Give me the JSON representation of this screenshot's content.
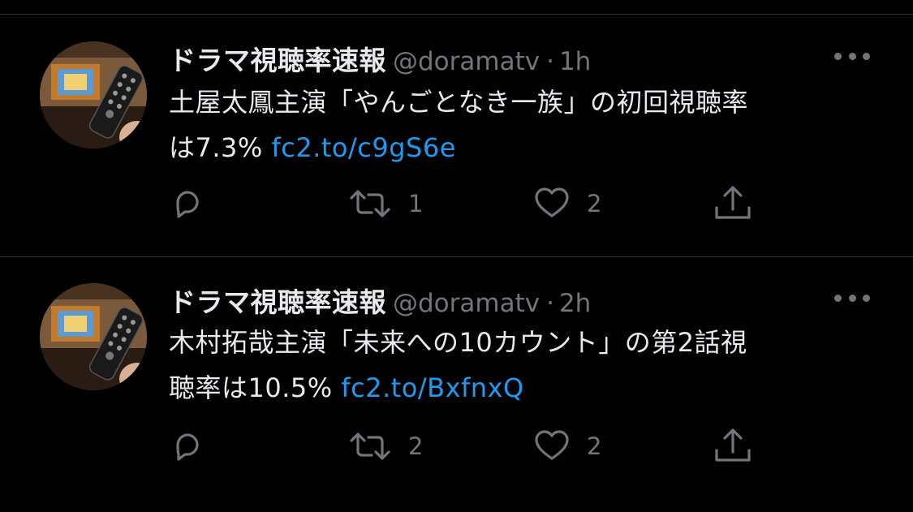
{
  "tweets": [
    {
      "name": "ドラマ視聴率速報",
      "handle": "@doramatv",
      "time": "1h",
      "text_line1": "土屋太鳳主演「やんごとなき一族」の初回視聴率",
      "text_line2": "は7.3%",
      "link": "fc2.to/c9gS6e",
      "replies": "",
      "retweets": "1",
      "likes": "2"
    },
    {
      "name": "ドラマ視聴率速報",
      "handle": "@doramatv",
      "time": "2h",
      "text_line1": "木村拓哉主演「未来への10カウント」の第2話視",
      "text_line2": "聴率は10.5%",
      "link": "fc2.to/BxfnxQ",
      "replies": "",
      "retweets": "2",
      "likes": "2"
    }
  ],
  "icons": [
    "reply-icon",
    "retweet-icon",
    "like-icon",
    "share-icon",
    "more-icon"
  ],
  "colors": {
    "background": "#000000",
    "text": "#e7e9ea",
    "muted": "#71767b",
    "link": "#1d9bf0",
    "divider": "#2f3336"
  }
}
